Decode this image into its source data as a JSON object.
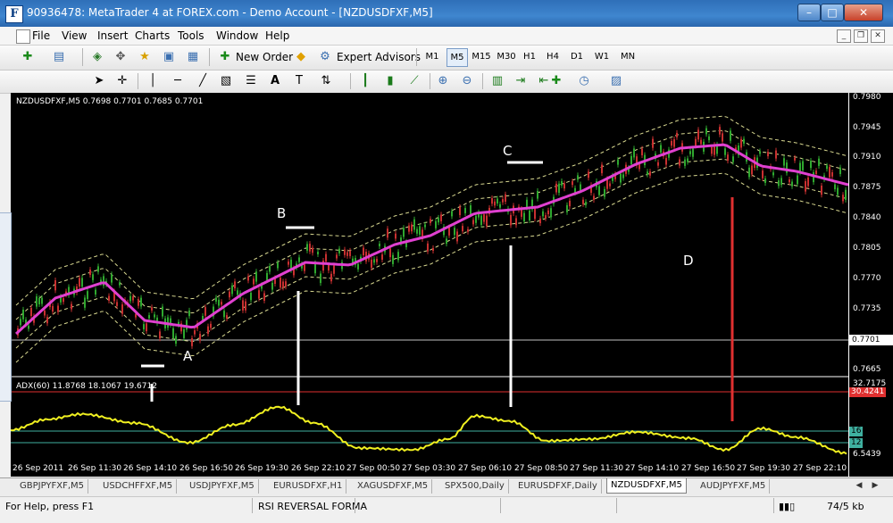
{
  "window": {
    "title": "90936478: MetaTrader 4 at FOREX.com - Demo Account - [NZDUSDFXF,M5]",
    "icon": "F",
    "minimize": "–",
    "maximize": "□",
    "close": "✕"
  },
  "menu": {
    "items": [
      "File",
      "View",
      "Insert",
      "Charts",
      "Tools",
      "Window",
      "Help"
    ]
  },
  "toolbar": {
    "new_order": "New Order",
    "expert_advisors": "Expert Advisors",
    "timeframes": [
      "M1",
      "M5",
      "M15",
      "M30",
      "H1",
      "H4",
      "D1",
      "W1",
      "MN"
    ],
    "active_timeframe": "M5"
  },
  "chart": {
    "symbol_info": "NZDUSDFXF,M5  0.7698 0.7701 0.7685 0.7701",
    "indicator_info": "ADX(60) 11.8768 18.1067 19.6712",
    "current_price": "0.7701",
    "price_labels": [
      "0.7980",
      "0.7945",
      "0.7910",
      "0.7875",
      "0.7840",
      "0.7805",
      "0.7770",
      "0.7735",
      "0.7665"
    ],
    "indicator_labels": {
      "max": "32.7175",
      "level_red": "30.4241",
      "level_16": "16",
      "level_12": "12",
      "min": "6.5439"
    },
    "time_labels": [
      "26 Sep 2011",
      "26 Sep 11:30",
      "26 Sep 14:10",
      "26 Sep 16:50",
      "26 Sep 19:30",
      "26 Sep 22:10",
      "27 Sep 00:50",
      "27 Sep 03:30",
      "27 Sep 06:10",
      "27 Sep 08:50",
      "27 Sep 11:30",
      "27 Sep 14:10",
      "27 Sep 16:50",
      "27 Sep 19:30",
      "27 Sep 22:10"
    ],
    "annotations": [
      "A",
      "B",
      "C",
      "D"
    ],
    "colors": {
      "ma": "#e040d0",
      "bands": "#d8d890",
      "adx": "#f0f020",
      "bull": "#2fa82f",
      "bear": "#c83030",
      "red_line": "#e03030"
    }
  },
  "tabs": {
    "items": [
      "GBPJPYFXF,M5",
      "USDCHFFXF,M5",
      "USDJPYFXF,M5",
      "EURUSDFXF,H1",
      "XAGUSDFXF,M5",
      "SPX500,Daily",
      "EURUSDFXF,Daily",
      "NZDUSDFXF,M5",
      "AUDJPYFXF,M5"
    ],
    "active": "NZDUSDFXF,M5"
  },
  "status": {
    "help": "For Help, press F1",
    "profile": "RSI REVERSAL FORMA",
    "traffic": "74/5 kb"
  }
}
